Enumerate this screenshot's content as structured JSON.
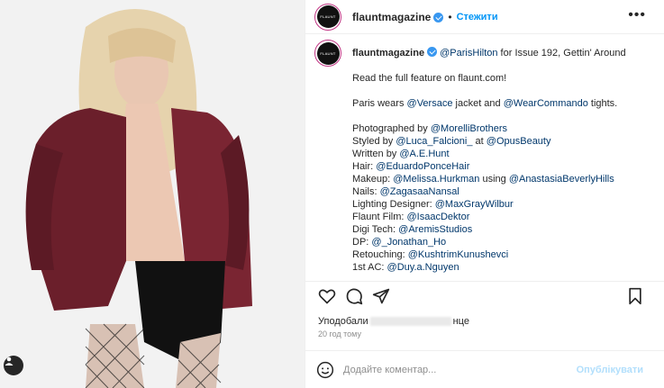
{
  "header": {
    "username": "flauntmagazine",
    "separator": "•",
    "follow_label": "Стежити",
    "more_label": "•••",
    "avatar_text": "FLAUNT"
  },
  "caption": {
    "username": "flauntmagazine",
    "mention": "@ParisHilton",
    "title_rest": " for Issue 192, Gettin' Around",
    "read_more": "Read the full feature on flaunt.com!",
    "wears_prefix": "Paris wears ",
    "wears_brand": "@Versace",
    "wears_mid": " jacket and ",
    "wears_brand2": "@WearCommando",
    "wears_suffix": " tights.",
    "credits": [
      {
        "label": "Photographed by ",
        "handle": "@MorelliBrothers",
        "extra_label": "",
        "extra_handle": ""
      },
      {
        "label": "Styled by ",
        "handle": "@Luca_Falcioni_",
        "extra_label": " at ",
        "extra_handle": "@OpusBeauty"
      },
      {
        "label": "Written by ",
        "handle": "@A.E.Hunt",
        "extra_label": "",
        "extra_handle": ""
      },
      {
        "label": "Hair: ",
        "handle": "@EduardoPonceHair",
        "extra_label": "",
        "extra_handle": ""
      },
      {
        "label": "Makeup: ",
        "handle": "@Melissa.Hurkman",
        "extra_label": " using ",
        "extra_handle": "@AnastasiaBeverlyHills"
      },
      {
        "label": "Nails: ",
        "handle": "@ZagasaaNansal",
        "extra_label": "",
        "extra_handle": ""
      },
      {
        "label": "Lighting Designer: ",
        "handle": "@MaxGrayWilbur",
        "extra_label": "",
        "extra_handle": ""
      },
      {
        "label": "Flaunt Film: ",
        "handle": "@IsaacDektor",
        "extra_label": "",
        "extra_handle": ""
      },
      {
        "label": "Digi Tech: ",
        "handle": "@AremisStudios",
        "extra_label": "",
        "extra_handle": ""
      },
      {
        "label": "DP: ",
        "handle": "@_Jonathan_Ho",
        "extra_label": "",
        "extra_handle": ""
      },
      {
        "label": "Retouching: ",
        "handle": "@KushtrimKunushevci",
        "extra_label": "",
        "extra_handle": ""
      },
      {
        "label": "1st AC: ",
        "handle": "@Duy.a.Nguyen",
        "extra_label": "",
        "extra_handle": ""
      }
    ]
  },
  "likes": {
    "prefix": "Уподобали",
    "suffix": "нце"
  },
  "time_ago": "20 год тому",
  "comment": {
    "placeholder": "Додайте коментар...",
    "publish_label": "Опублікувати"
  },
  "colors": {
    "accent": "#0095f6",
    "mention": "#00376b",
    "jacket": "#6b1f2b"
  },
  "icons": [
    "heart-icon",
    "comment-icon",
    "share-icon",
    "bookmark-icon",
    "emoji-icon",
    "user-tag-icon",
    "verified-badge-icon",
    "more-options-icon"
  ]
}
